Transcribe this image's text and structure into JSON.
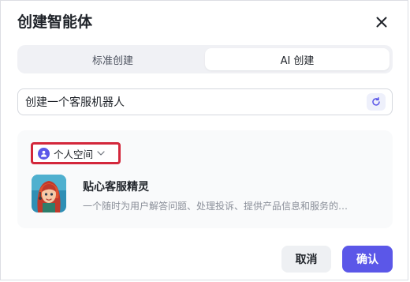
{
  "dialog": {
    "title": "创建智能体",
    "close_icon": "close-icon"
  },
  "tabs": [
    {
      "label": "标准创建",
      "active": false
    },
    {
      "label": "AI 创建",
      "active": true
    }
  ],
  "prompt": {
    "value": "创建一个客服机器人",
    "refresh_icon": "refresh-icon"
  },
  "preview": {
    "space_selector": {
      "label": "个人空间",
      "icon": "user-icon",
      "chevron": "chevron-down-icon",
      "highlight_color": "#d3273b"
    },
    "agent": {
      "name": "贴心客服精灵",
      "description": "一个随时为用户解答问题、处理投诉、提供产品信息和服务的…",
      "avatar": "agent-avatar-illustration"
    }
  },
  "actions": {
    "cancel_label": "取消",
    "confirm_label": "确认"
  },
  "colors": {
    "accent": "#5b57e8",
    "tab_track": "#f0f1f5",
    "preview_bg": "#f9fafb",
    "muted_text": "#8a8f99"
  }
}
